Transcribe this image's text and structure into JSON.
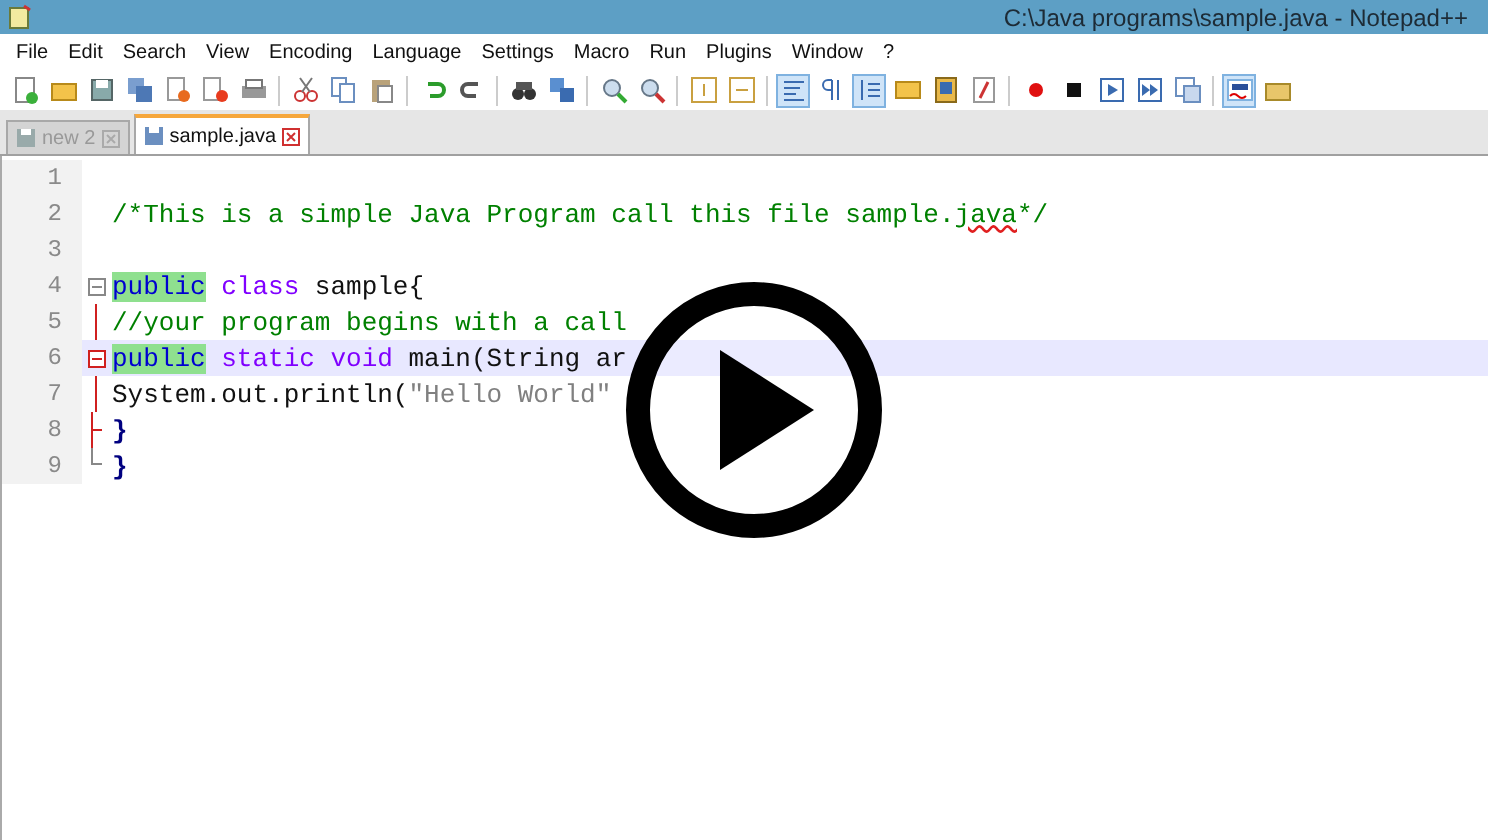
{
  "window": {
    "title": "C:\\Java programs\\sample.java - Notepad++"
  },
  "menu": [
    "File",
    "Edit",
    "Search",
    "View",
    "Encoding",
    "Language",
    "Settings",
    "Macro",
    "Run",
    "Plugins",
    "Window",
    "?"
  ],
  "toolbar": [
    {
      "kind": "new",
      "selected": false
    },
    {
      "kind": "open",
      "selected": false
    },
    {
      "kind": "save",
      "selected": false
    },
    {
      "kind": "save-all",
      "selected": false
    },
    {
      "kind": "close",
      "selected": false
    },
    {
      "kind": "close-all",
      "selected": false
    },
    {
      "kind": "print",
      "selected": false
    },
    {
      "kind": "separator"
    },
    {
      "kind": "cut",
      "selected": false
    },
    {
      "kind": "copy",
      "selected": false
    },
    {
      "kind": "paste",
      "selected": false
    },
    {
      "kind": "separator"
    },
    {
      "kind": "undo",
      "selected": false
    },
    {
      "kind": "redo",
      "selected": false
    },
    {
      "kind": "separator"
    },
    {
      "kind": "find",
      "selected": false
    },
    {
      "kind": "replace",
      "selected": false
    },
    {
      "kind": "separator"
    },
    {
      "kind": "zoom-in",
      "selected": false
    },
    {
      "kind": "zoom-out",
      "selected": false
    },
    {
      "kind": "separator"
    },
    {
      "kind": "sync-v",
      "selected": false
    },
    {
      "kind": "sync-h",
      "selected": false
    },
    {
      "kind": "separator"
    },
    {
      "kind": "wrap",
      "selected": true
    },
    {
      "kind": "all-chars",
      "selected": false
    },
    {
      "kind": "indent-guide",
      "selected": true
    },
    {
      "kind": "udl",
      "selected": false
    },
    {
      "kind": "doc-map",
      "selected": false
    },
    {
      "kind": "function-list",
      "selected": false
    },
    {
      "kind": "separator"
    },
    {
      "kind": "record",
      "selected": false
    },
    {
      "kind": "stop",
      "selected": false
    },
    {
      "kind": "play",
      "selected": false
    },
    {
      "kind": "play-multi",
      "selected": false
    },
    {
      "kind": "save-macro",
      "selected": false
    },
    {
      "kind": "separator"
    },
    {
      "kind": "spell",
      "selected": true
    },
    {
      "kind": "folder",
      "selected": false
    }
  ],
  "tabs": [
    {
      "label": "new 2",
      "selected": false
    },
    {
      "label": "sample.java",
      "selected": true
    }
  ],
  "lines": [
    {
      "number": "1",
      "current": false
    },
    {
      "number": "2",
      "current": false,
      "tokens": [
        {
          "text": "/*This is a simple Java Program call this file sample.",
          "kind": "comment"
        },
        {
          "text": "java",
          "kind": "comment",
          "misspelled": true
        },
        {
          "text": "*/",
          "kind": "comment"
        }
      ]
    },
    {
      "number": "3",
      "current": false
    },
    {
      "number": "4",
      "current": false,
      "kind": "fold-start",
      "tokens": [
        {
          "text": "public",
          "kind": "keyword",
          "highlighted": true
        },
        {
          "text": " class",
          "kind": "type"
        },
        {
          "text": " sample{",
          "kind": "plain"
        }
      ]
    },
    {
      "number": "5",
      "current": false,
      "kind": "fold-body",
      "tokens": [
        {
          "text": "//your program begins with a call",
          "kind": "comment"
        }
      ]
    },
    {
      "number": "6",
      "current": true,
      "kind": "fold-start-marked",
      "tokens": [
        {
          "text": "public",
          "kind": "keyword",
          "highlighted": true
        },
        {
          "text": " static",
          "kind": "type"
        },
        {
          "text": " void",
          "kind": "type"
        },
        {
          "text": " main(String ar",
          "kind": "plain"
        }
      ]
    },
    {
      "number": "7",
      "current": false,
      "kind": "fold-body",
      "tokens": [
        {
          "text": "System.out.println(",
          "kind": "plain"
        },
        {
          "text": "\"Hello World\"",
          "kind": "string"
        }
      ]
    },
    {
      "number": "8",
      "current": false,
      "kind": "fold-tee",
      "tokens": [
        {
          "text": "}",
          "kind": "brace"
        }
      ]
    },
    {
      "number": "9",
      "current": false,
      "kind": "fold-end",
      "tokens": [
        {
          "text": "}",
          "kind": "brace"
        }
      ]
    }
  ],
  "player": {
    "kind": "play"
  }
}
